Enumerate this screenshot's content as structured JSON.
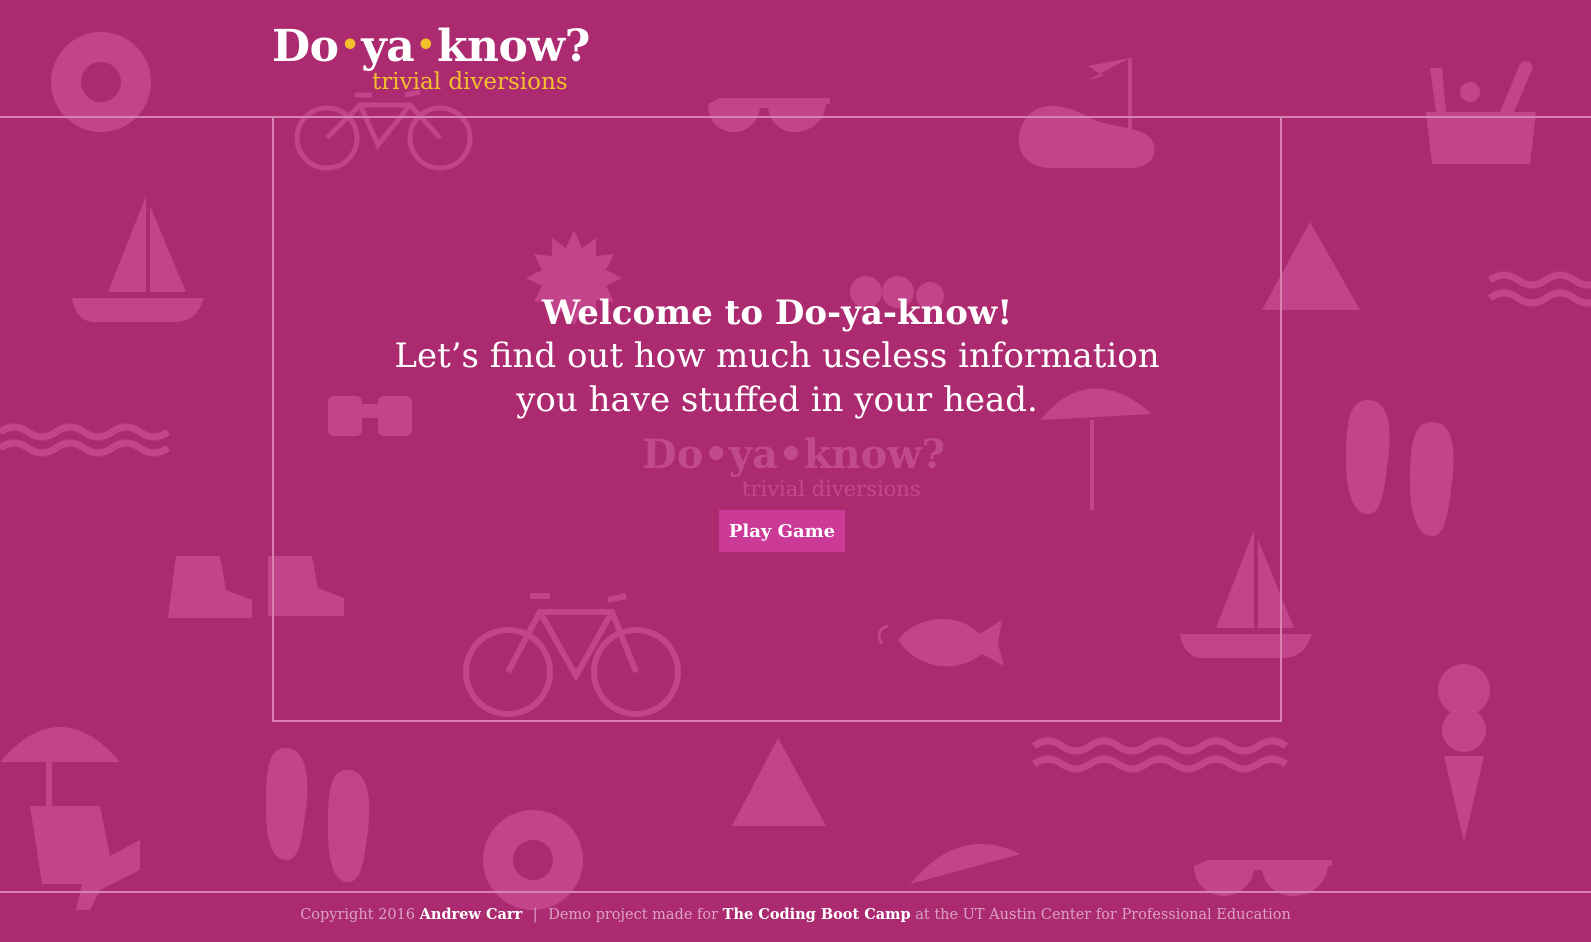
{
  "header": {
    "logo": {
      "word1": "Do",
      "word2": "ya",
      "word3": "know?",
      "dot": "•",
      "tagline": "trivial diversions"
    }
  },
  "main": {
    "title": "Welcome to Do-ya-know!",
    "line1": "Let’s find out how much useless information",
    "line2": "you have stuffed in your head.",
    "watermark": {
      "main": "Do•ya•know?",
      "tagline": "trivial diversions"
    },
    "play_button": "Play Game"
  },
  "footer": {
    "copyright": "Copyright 2016",
    "author": "Andrew Carr",
    "separator": "|",
    "demo_text": "Demo project made for",
    "bootcamp": "The Coding Boot Camp",
    "suffix": "at the UT Austin Center for Professional Education"
  },
  "colors": {
    "background": "#ac2a70",
    "accent_yellow": "#f2c02c",
    "button": "#cb3a97",
    "rule": "#d882b1"
  },
  "background_icons": [
    "life-ring-icon",
    "bicycle-icon",
    "sunglasses-icon",
    "golf-flag-icon",
    "picnic-basket-icon",
    "sailboat-icon",
    "sun-icon",
    "cherries-icon",
    "tent-icon",
    "waves-icon",
    "binoculars-icon",
    "beach-umbrella-icon",
    "flip-flops-icon",
    "hiking-boots-icon",
    "fish-icon",
    "ice-cream-icon",
    "beach-chair-icon"
  ]
}
